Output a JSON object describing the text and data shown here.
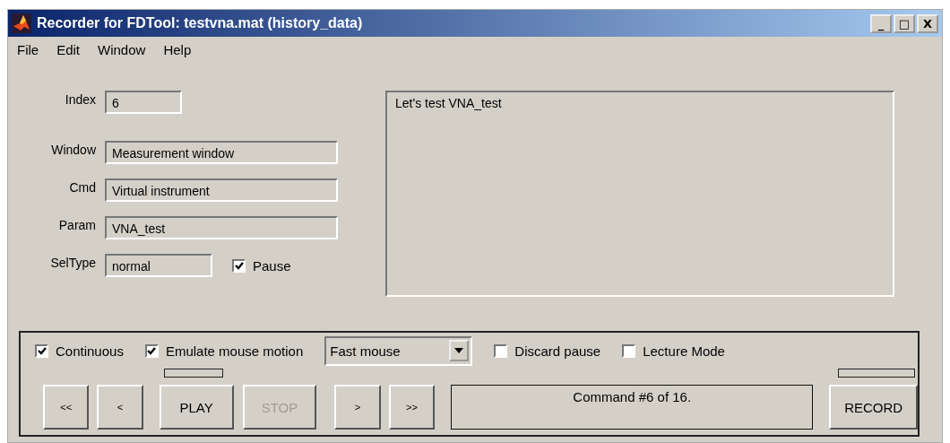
{
  "window": {
    "title": "Recorder for FDTool: testvna.mat (history_data)",
    "controls": [
      "_",
      "□",
      "X"
    ]
  },
  "menu": [
    {
      "label": "File"
    },
    {
      "label": "Edit"
    },
    {
      "label": "Window"
    },
    {
      "label": "Help"
    }
  ],
  "fields": [
    {
      "label": "Index",
      "value": "6",
      "kind": "short"
    },
    {
      "label": "Window",
      "value": "Measurement window",
      "kind": "long"
    },
    {
      "label": "Cmd",
      "value": "Virtual instrument",
      "kind": "long"
    },
    {
      "label": "Param",
      "value": "VNA_test",
      "kind": "long"
    },
    {
      "label": "SelType",
      "value": "normal",
      "kind": "medium"
    }
  ],
  "pause": {
    "label": "Pause",
    "checked": true
  },
  "message": "Let's test VNA_test",
  "options": [
    {
      "kind": "checkbox",
      "label": "Continuous",
      "checked": true
    },
    {
      "kind": "checkbox",
      "label": "Emulate mouse motion",
      "checked": true
    },
    {
      "kind": "dropdown",
      "value": "Fast mouse"
    },
    {
      "kind": "checkbox",
      "label": "Discard pause",
      "checked": false
    },
    {
      "kind": "checkbox",
      "label": "Lecture Mode",
      "checked": false
    }
  ],
  "buttons": [
    {
      "label": "<<",
      "disabled": false
    },
    {
      "label": "<",
      "disabled": false
    },
    {
      "label": "PLAY",
      "disabled": false
    },
    {
      "label": "STOP",
      "disabled": true
    },
    {
      "label": ">",
      "disabled": false
    },
    {
      "label": ">>",
      "disabled": false
    }
  ],
  "status": "Command #6 of 16.",
  "record_button": {
    "label": "RECORD",
    "disabled": false
  }
}
